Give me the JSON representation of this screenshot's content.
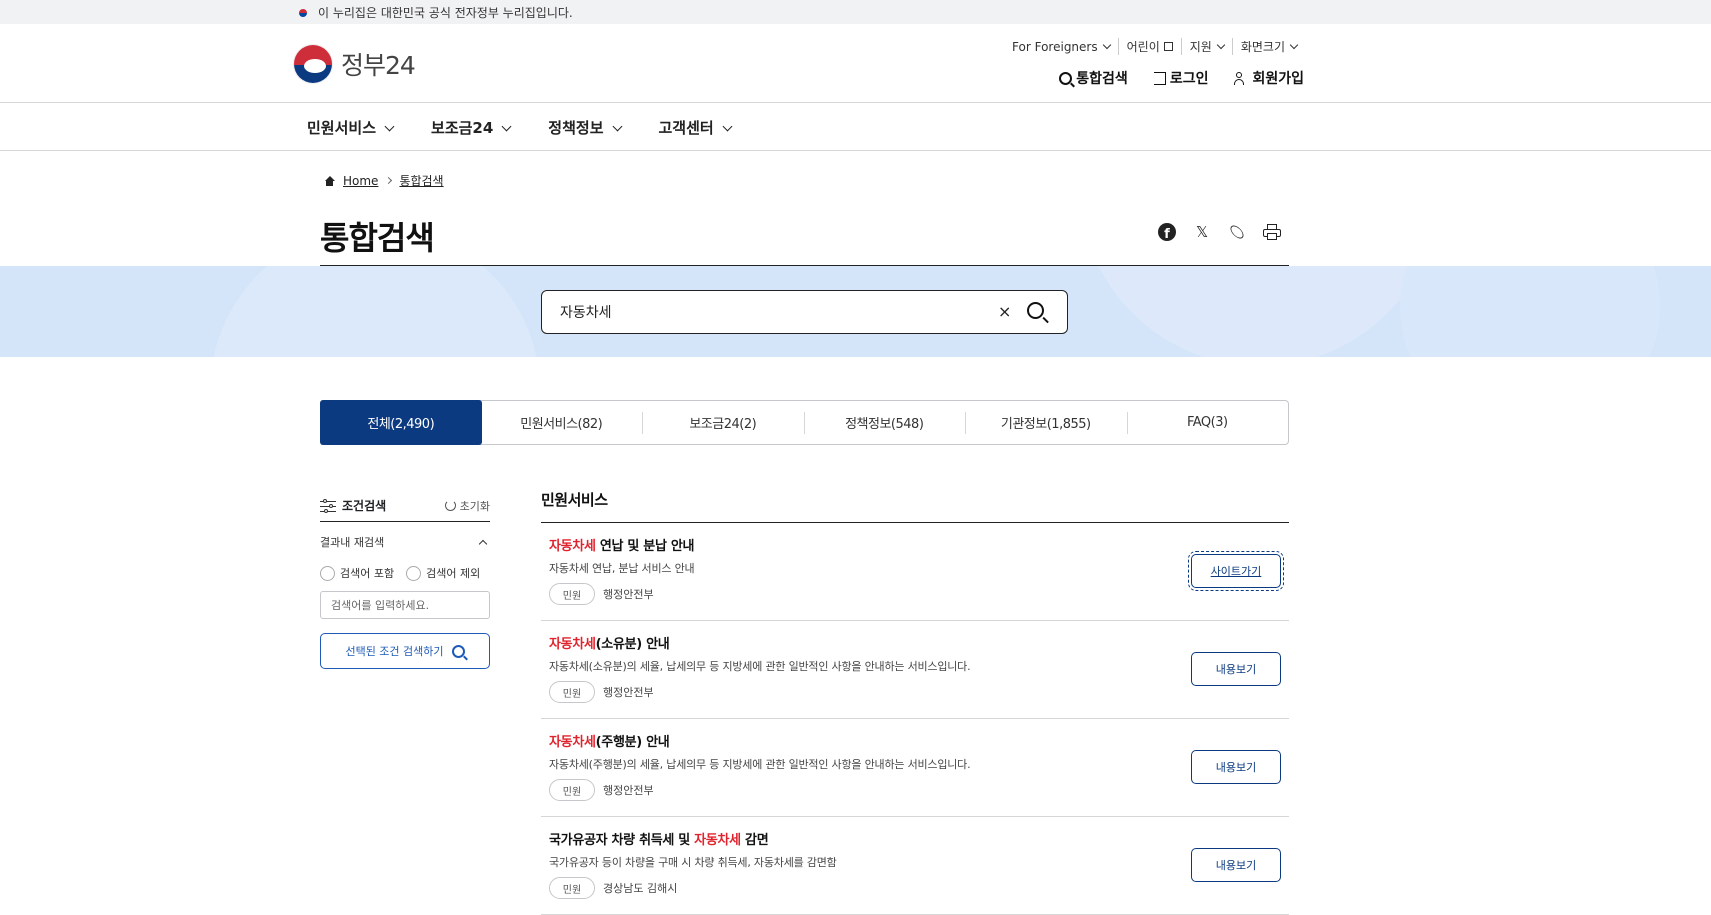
{
  "gov_banner": {
    "text": "이 누리집은 대한민국 공식 전자정부 누리집입니다."
  },
  "logo": {
    "text": "정부24"
  },
  "util_menu": [
    {
      "label": "For Foreigners",
      "icon": "chevron-down-icon"
    },
    {
      "label": "어린이",
      "icon": "external-link-icon"
    },
    {
      "label": "지원",
      "icon": "chevron-down-icon"
    },
    {
      "label": "화면크기",
      "icon": "chevron-down-icon"
    }
  ],
  "auth": {
    "search": "통합검색",
    "login": "로그인",
    "signup": "회원가입"
  },
  "gnb": [
    "민원서비스",
    "보조금24",
    "정책정보",
    "고객센터"
  ],
  "breadcrumb": {
    "home": "Home",
    "current": "통합검색"
  },
  "page_title": "통합검색",
  "search": {
    "value": "자동차세",
    "clear": "×"
  },
  "tabs": [
    "전체(2,490)",
    "민원서비스(82)",
    "보조금24(2)",
    "정책정보(548)",
    "기관정보(1,855)",
    "FAQ(3)"
  ],
  "filter": {
    "title": "조건검색",
    "reset": "초기화",
    "sub_title": "결과내 재검색",
    "include": "검색어 포함",
    "exclude": "검색어 제외",
    "placeholder": "검색어를 입력하세요.",
    "submit": "선택된 조건 검색하기"
  },
  "results": {
    "section_title": "민원서비스",
    "items": [
      {
        "highlight": "자동차세",
        "title_before": "",
        "title_after": " 연납 및 분납 안내",
        "desc": "자동차세 연납, 분납 서비스 안내",
        "badge": "민원",
        "org": "행정안전부",
        "button": "사이트가기"
      },
      {
        "highlight": "자동차세",
        "title_before": "",
        "title_after": "(소유분) 안내",
        "desc": "자동차세(소유분)의 세율, 납세의무 등 지방세에 관한 일반적인 사항을 안내하는 서비스입니다.",
        "badge": "민원",
        "org": "행정안전부",
        "button": "내용보기"
      },
      {
        "highlight": "자동차세",
        "title_before": "",
        "title_after": "(주행분) 안내",
        "desc": "자동차세(주행분)의 세율, 납세의무 등 지방세에 관한 일반적인 사항을 안내하는 서비스입니다.",
        "badge": "민원",
        "org": "행정안전부",
        "button": "내용보기"
      },
      {
        "highlight": "자동차세",
        "title_before": "국가유공자 차량 취득세 및 ",
        "title_after": " 감면",
        "desc": "국가유공자 등이 차량을 구매 시 차량 취득세, 자동차세를 감면함",
        "badge": "민원",
        "org": "경상남도 김해시",
        "button": "내용보기"
      }
    ]
  },
  "colors": {
    "primary": "#0b3a80",
    "highlight": "#e0242e",
    "band": "#d4e5fa"
  }
}
